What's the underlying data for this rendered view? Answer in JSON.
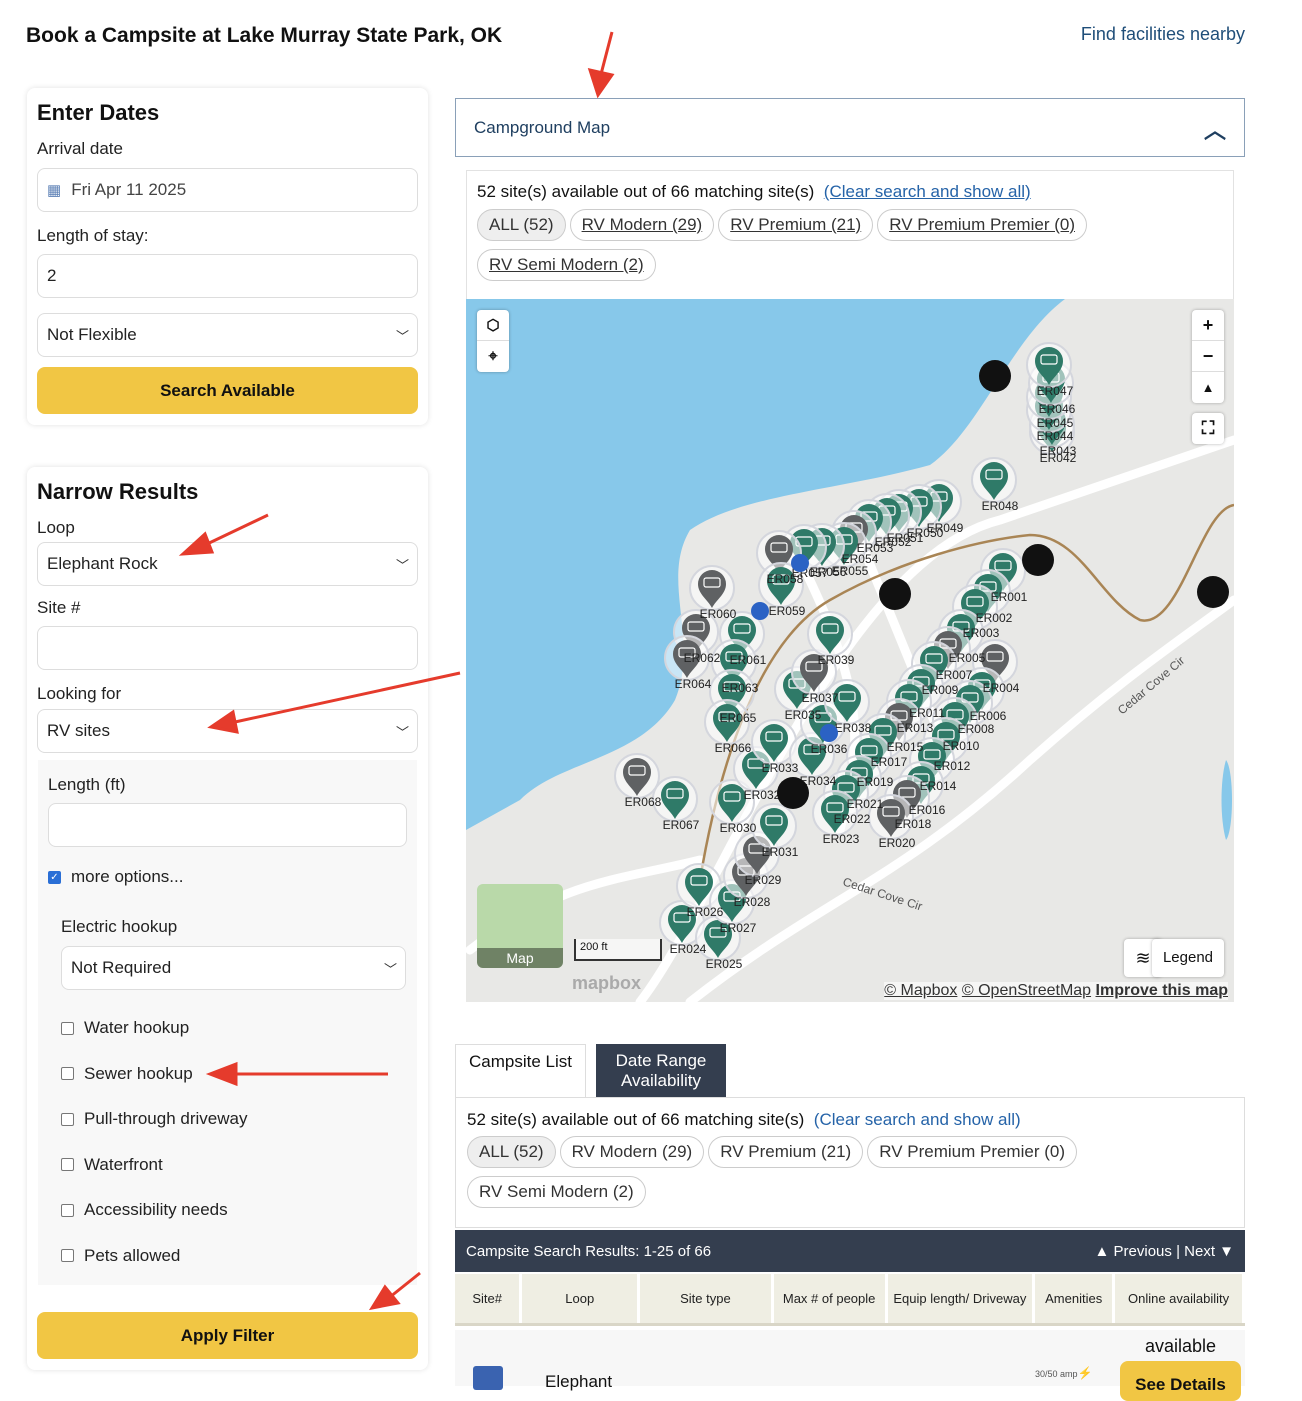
{
  "header": {
    "title": "Book a Campsite at Lake Murray State Park, OK",
    "find_link": "Find facilities nearby"
  },
  "dates": {
    "heading": "Enter Dates",
    "arrival_label": "Arrival date",
    "arrival_value": "Fri Apr 11 2025",
    "stay_label": "Length of stay:",
    "stay_value": "2",
    "flex_value": "Not Flexible",
    "search_button": "Search Available"
  },
  "narrow": {
    "heading": "Narrow Results",
    "loop_label": "Loop",
    "loop_value": "Elephant Rock",
    "site_label": "Site #",
    "site_value": "",
    "looking_label": "Looking for",
    "looking_value": "RV sites",
    "length_label": "Length (ft)",
    "length_value": "",
    "more_options": "more options...",
    "more_options_checked": true,
    "electric_label": "Electric hookup",
    "electric_value": "Not Required",
    "checkboxes": [
      {
        "label": "Water hookup",
        "checked": false
      },
      {
        "label": "Sewer hookup",
        "checked": false
      },
      {
        "label": "Pull-through driveway",
        "checked": false
      },
      {
        "label": "Waterfront",
        "checked": false
      },
      {
        "label": "Accessibility needs",
        "checked": false
      },
      {
        "label": "Pets allowed",
        "checked": false
      }
    ],
    "apply_button": "Apply Filter"
  },
  "map_panel": {
    "title": "Campground Map",
    "summary": "52 site(s) available out of 66 matching site(s)",
    "clear_link": "(Clear search and show all)",
    "filters": [
      "ALL (52)",
      "RV Modern (29)",
      "RV Premium (21)",
      "RV Premium Premier (0)",
      "RV Semi Modern (2)"
    ],
    "map": {
      "thumb_label": "Map",
      "scale": "200 ft",
      "legend_button": "Legend",
      "logo": "mapbox",
      "attrib_mapbox": "© Mapbox",
      "attrib_osm": "© OpenStreetMap",
      "attrib_improve": "Improve this map",
      "road_label_1": "Cedar Cove Cir",
      "road_label_2": "Cedar Cove Cir",
      "colors": {
        "water": "#87c8ea",
        "land": "#e8e8e6",
        "available": "#2f7a68",
        "unavailable": "#5f6163"
      },
      "sites": [
        {
          "id": "ER001",
          "a": true
        },
        {
          "id": "ER002",
          "a": true
        },
        {
          "id": "ER003",
          "a": true
        },
        {
          "id": "ER004",
          "a": false
        },
        {
          "id": "ER005",
          "a": true
        },
        {
          "id": "ER006",
          "a": true
        },
        {
          "id": "ER007",
          "a": false
        },
        {
          "id": "ER008",
          "a": true
        },
        {
          "id": "ER009",
          "a": true
        },
        {
          "id": "ER010",
          "a": true
        },
        {
          "id": "ER011",
          "a": true
        },
        {
          "id": "ER012",
          "a": true
        },
        {
          "id": "ER013",
          "a": true
        },
        {
          "id": "ER014",
          "a": true
        },
        {
          "id": "ER015",
          "a": false
        },
        {
          "id": "ER016",
          "a": true
        },
        {
          "id": "ER017",
          "a": true
        },
        {
          "id": "ER018",
          "a": false
        },
        {
          "id": "ER019",
          "a": true
        },
        {
          "id": "ER020",
          "a": false
        },
        {
          "id": "ER021",
          "a": true
        },
        {
          "id": "ER022",
          "a": true
        },
        {
          "id": "ER023",
          "a": true
        },
        {
          "id": "ER024",
          "a": true
        },
        {
          "id": "ER025",
          "a": true
        },
        {
          "id": "ER026",
          "a": true
        },
        {
          "id": "ER027",
          "a": true
        },
        {
          "id": "ER028",
          "a": false
        },
        {
          "id": "ER029",
          "a": false
        },
        {
          "id": "ER030",
          "a": true
        },
        {
          "id": "ER031",
          "a": true
        },
        {
          "id": "ER032",
          "a": true
        },
        {
          "id": "ER033",
          "a": true
        },
        {
          "id": "ER034",
          "a": true
        },
        {
          "id": "ER035",
          "a": true
        },
        {
          "id": "ER036",
          "a": true
        },
        {
          "id": "ER037",
          "a": false
        },
        {
          "id": "ER038",
          "a": true
        },
        {
          "id": "ER039",
          "a": true
        },
        {
          "id": "ER042",
          "a": true
        },
        {
          "id": "ER043",
          "a": true
        },
        {
          "id": "ER044",
          "a": true
        },
        {
          "id": "ER045",
          "a": true
        },
        {
          "id": "ER046",
          "a": true
        },
        {
          "id": "ER047",
          "a": true
        },
        {
          "id": "ER048",
          "a": true
        },
        {
          "id": "ER049",
          "a": true
        },
        {
          "id": "ER050",
          "a": true
        },
        {
          "id": "ER051",
          "a": true
        },
        {
          "id": "ER052",
          "a": true
        },
        {
          "id": "ER053",
          "a": true
        },
        {
          "id": "ER054",
          "a": false
        },
        {
          "id": "ER055",
          "a": true
        },
        {
          "id": "ER056",
          "a": true
        },
        {
          "id": "ER057",
          "a": true
        },
        {
          "id": "ER058",
          "a": false
        },
        {
          "id": "ER059",
          "a": true
        },
        {
          "id": "ER060",
          "a": false
        },
        {
          "id": "ER061",
          "a": true
        },
        {
          "id": "ER062",
          "a": false
        },
        {
          "id": "ER063",
          "a": true
        },
        {
          "id": "ER064",
          "a": false
        },
        {
          "id": "ER065",
          "a": true
        },
        {
          "id": "ER066",
          "a": true
        },
        {
          "id": "ER067",
          "a": true
        },
        {
          "id": "ER068",
          "a": false
        }
      ]
    }
  },
  "tabs": [
    {
      "label": "Campsite List",
      "active": true
    },
    {
      "label": "Date Range Availability",
      "active": false
    }
  ],
  "list_panel": {
    "summary": "52 site(s) available out of 66 matching site(s)",
    "clear_link": "(Clear search and show all)",
    "filters": [
      "ALL (52)",
      "RV Modern (29)",
      "RV Premium (21)",
      "RV Premium Premier (0)",
      "RV Semi Modern (2)"
    ]
  },
  "results": {
    "title": "Campsite Search Results: 1-25 of 66",
    "previous": "▲ Previous",
    "next": "Next ▼",
    "columns": [
      "Site#",
      "Loop",
      "Site type",
      "Max # of people",
      "Equip length/ Driveway",
      "Amenities",
      "Online availability"
    ],
    "row": {
      "loop": "Elephant",
      "availability": "available",
      "details_button": "See Details",
      "amenity": "30/50 amp"
    }
  },
  "colors": {
    "accent": "#f1c644",
    "dark_bar": "#343e4f",
    "link": "#2563a8"
  }
}
